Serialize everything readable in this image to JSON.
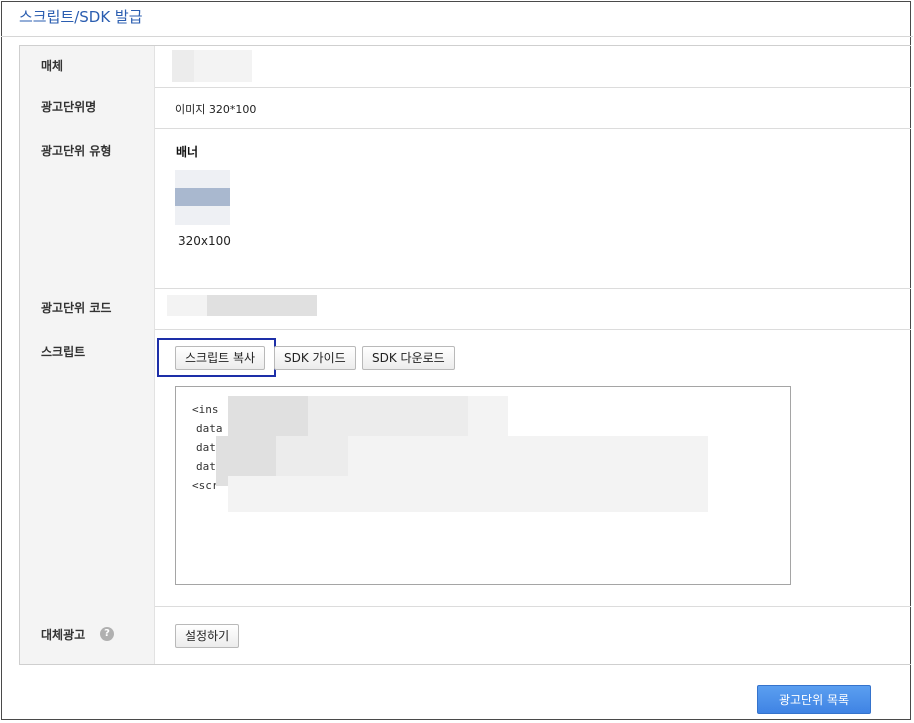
{
  "page": {
    "title": "스크립트/SDK 발급"
  },
  "rows": {
    "media": {
      "label": "매체"
    },
    "unit_name": {
      "label": "광고단위명",
      "value": "이미지 320*100"
    },
    "unit_type": {
      "label": "광고단위 유형",
      "type_name": "배너",
      "size": "320x100"
    },
    "unit_code": {
      "label": "광고단위 코드"
    },
    "script": {
      "label": "스크립트",
      "buttons": {
        "copy": "스크립트 복사",
        "sdk_guide": "SDK 가이드",
        "sdk_download": "SDK 다운로드"
      },
      "code_lines": [
        "<ins",
        "data",
        "data",
        "data",
        "<scr"
      ]
    },
    "fallback_ad": {
      "label": "대체광고",
      "button": "설정하기",
      "help_icon": "question-icon"
    }
  },
  "footer": {
    "list_button": "광고단위 목록"
  },
  "colors": {
    "title": "#2a5db0",
    "primary": "#4a8ee8",
    "highlight": "#1d2fa8"
  }
}
